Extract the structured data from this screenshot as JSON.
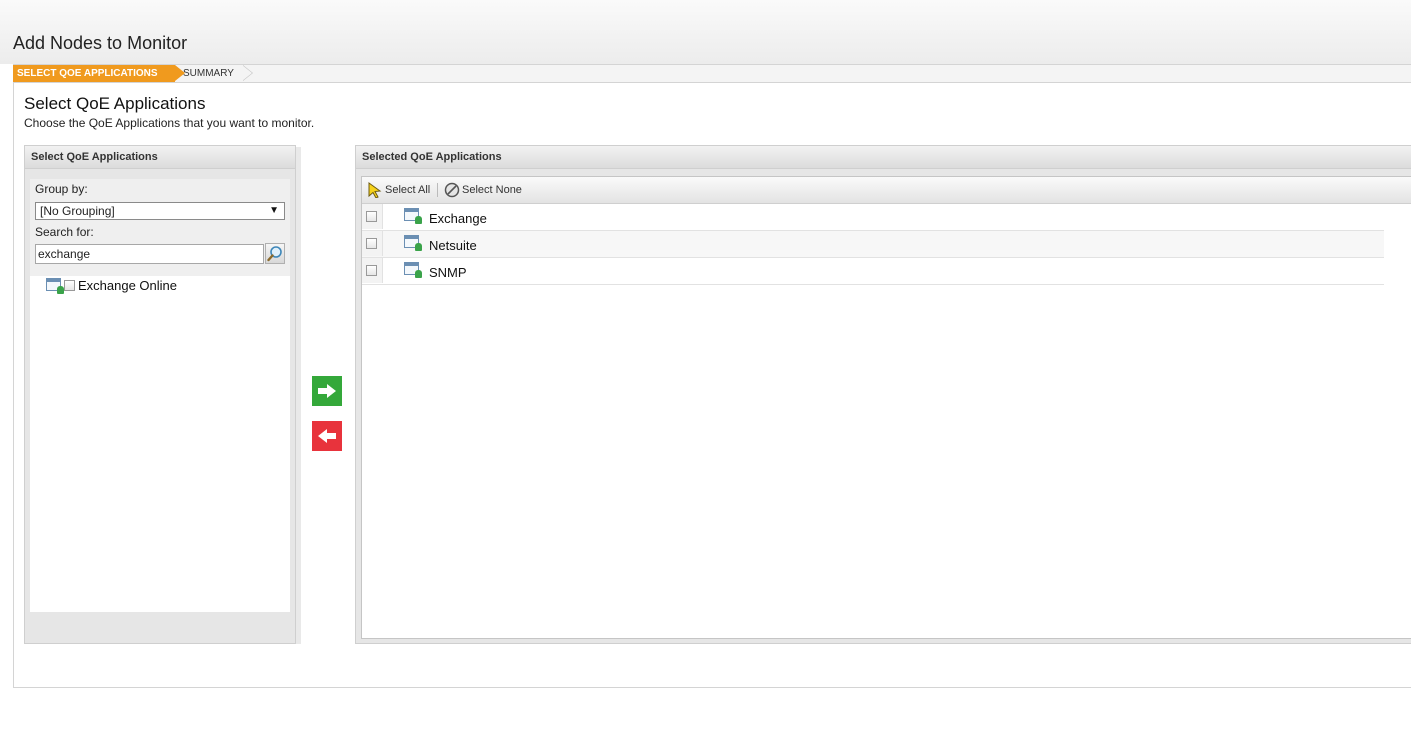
{
  "page": {
    "title": "Add Nodes to Monitor",
    "steps": [
      {
        "label": "SELECT QOE APPLICATIONS",
        "active": true
      },
      {
        "label": "SUMMARY",
        "active": false
      }
    ],
    "section_title": "Select QoE Applications",
    "section_description": "Choose the QoE Applications that you want to monitor."
  },
  "left_panel": {
    "header": "Select QoE Applications",
    "group_by_label": "Group by:",
    "group_by_value": "[No Grouping]",
    "search_label": "Search for:",
    "search_value": "exchange",
    "items": [
      {
        "label": "Exchange Online",
        "checked": false,
        "icon": "app-server-icon"
      }
    ]
  },
  "transfer": {
    "add_icon": "arrow-right-icon",
    "remove_icon": "arrow-left-icon",
    "add_color": "#34a83a",
    "remove_color": "#e8333c"
  },
  "right_panel": {
    "header": "Selected QoE Applications",
    "select_all_label": "Select All",
    "select_none_label": "Select None",
    "items": [
      {
        "label": "Exchange",
        "checked": false,
        "icon": "app-server-icon"
      },
      {
        "label": "Netsuite",
        "checked": false,
        "icon": "app-server-icon"
      },
      {
        "label": "SNMP",
        "checked": false,
        "icon": "app-server-icon"
      }
    ]
  },
  "colors": {
    "active_step": "#f09a1e"
  }
}
